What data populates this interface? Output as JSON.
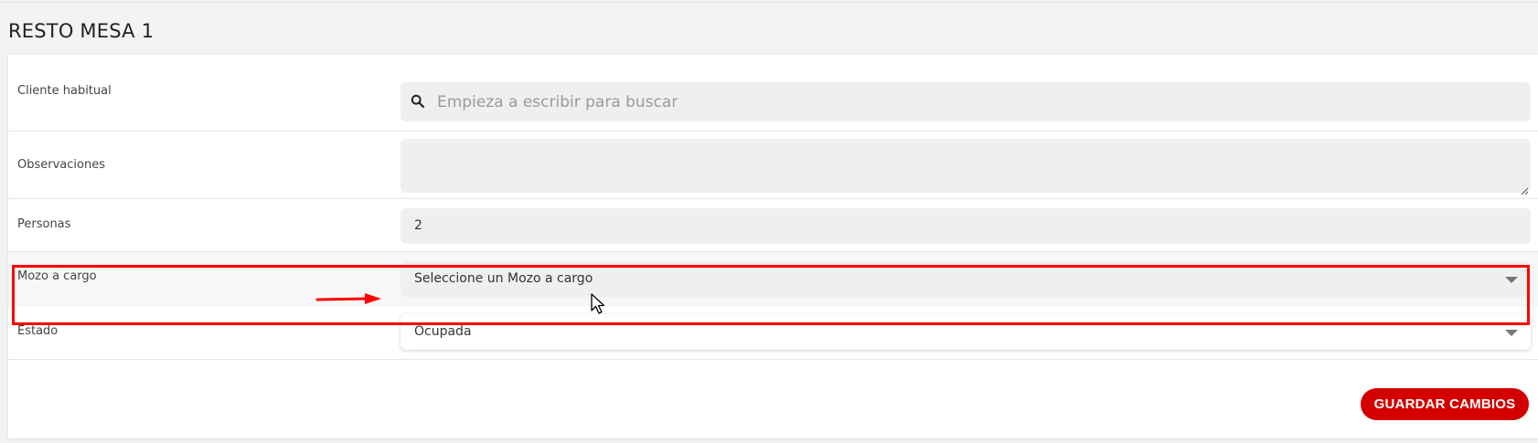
{
  "page": {
    "title": "RESTO MESA 1"
  },
  "form": {
    "cliente": {
      "label": "Cliente habitual",
      "placeholder": "Empieza a escribir para buscar",
      "value": ""
    },
    "observaciones": {
      "label": "Observaciones",
      "value": ""
    },
    "personas": {
      "label": "Personas",
      "value": "2"
    },
    "mozo": {
      "label": "Mozo a cargo",
      "selected": "Seleccione un Mozo a cargo"
    },
    "estado": {
      "label": "Estado",
      "selected": "Ocupada"
    }
  },
  "actions": {
    "save_label": "GUARDAR CAMBIOS"
  },
  "annotations": {
    "highlight_color": "#ff0000"
  },
  "colors": {
    "accent": "#d40000",
    "field_bg": "#efefef",
    "page_bg": "#f2f3f4"
  },
  "icons": {
    "search": "search-icon",
    "dropdown": "chevron-down-icon",
    "cursor": "mouse-cursor-icon",
    "resize": "resize-grip-icon",
    "arrow": "arrow-right-icon"
  }
}
